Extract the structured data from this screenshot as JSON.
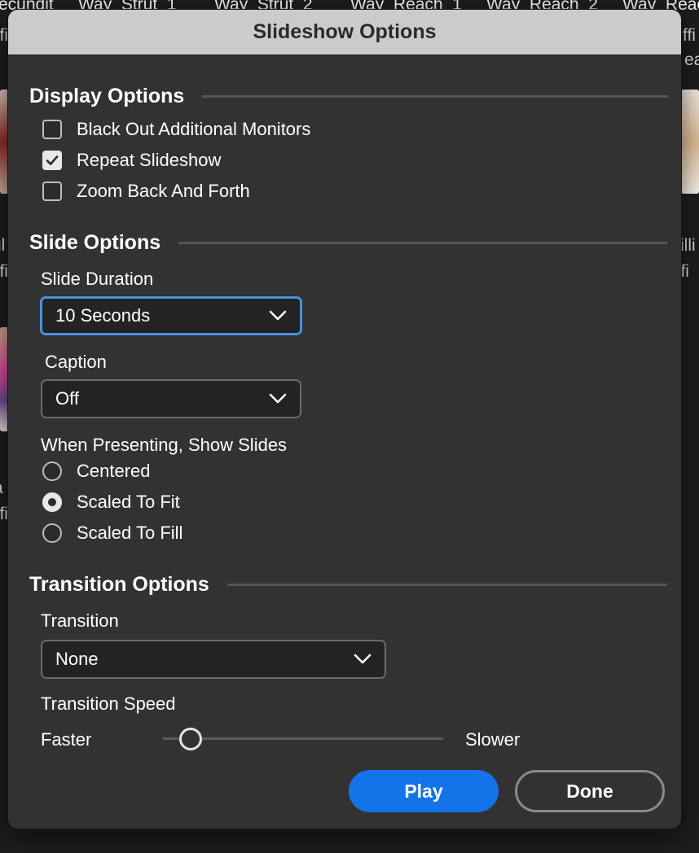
{
  "background": {
    "top_labels": [
      "ecundit",
      "Way_Strut_1",
      "Way_Strut_2",
      "Way_Reach_1",
      "Way_Reach_2",
      "Way_Reac"
    ],
    "side_labels_left": [
      "ffi",
      "ul",
      "ffi",
      "a",
      "ffi"
    ],
    "side_labels_right": [
      "ffi",
      "rilli",
      "ffi",
      "ea"
    ]
  },
  "dialog": {
    "title": "Slideshow Options",
    "display_options": {
      "heading": "Display Options",
      "options": [
        {
          "label": "Black Out Additional Monitors",
          "checked": false
        },
        {
          "label": "Repeat Slideshow",
          "checked": true
        },
        {
          "label": "Zoom Back And Forth",
          "checked": false
        }
      ]
    },
    "slide_options": {
      "heading": "Slide Options",
      "duration_label": "Slide Duration",
      "duration_value": "10 Seconds",
      "caption_label": "Caption",
      "caption_value": "Off",
      "show_slides_label": "When Presenting, Show Slides",
      "show_slides_options": [
        {
          "label": "Centered",
          "selected": false
        },
        {
          "label": "Scaled To Fit",
          "selected": true
        },
        {
          "label": "Scaled To Fill",
          "selected": false
        }
      ]
    },
    "transition_options": {
      "heading": "Transition Options",
      "transition_label": "Transition",
      "transition_value": "None",
      "speed_label": "Transition Speed",
      "speed_min_label": "Faster",
      "speed_max_label": "Slower",
      "speed_value": 0.1
    },
    "buttons": {
      "play": "Play",
      "done": "Done"
    }
  },
  "colors": {
    "accent": "#1473e6",
    "focus_ring": "#4a90d9",
    "dialog_bg": "#323232",
    "titlebar_bg": "#c9ccc9"
  },
  "icons": {
    "checkmark": "check-icon",
    "dropdown": "chevron-down-icon"
  }
}
